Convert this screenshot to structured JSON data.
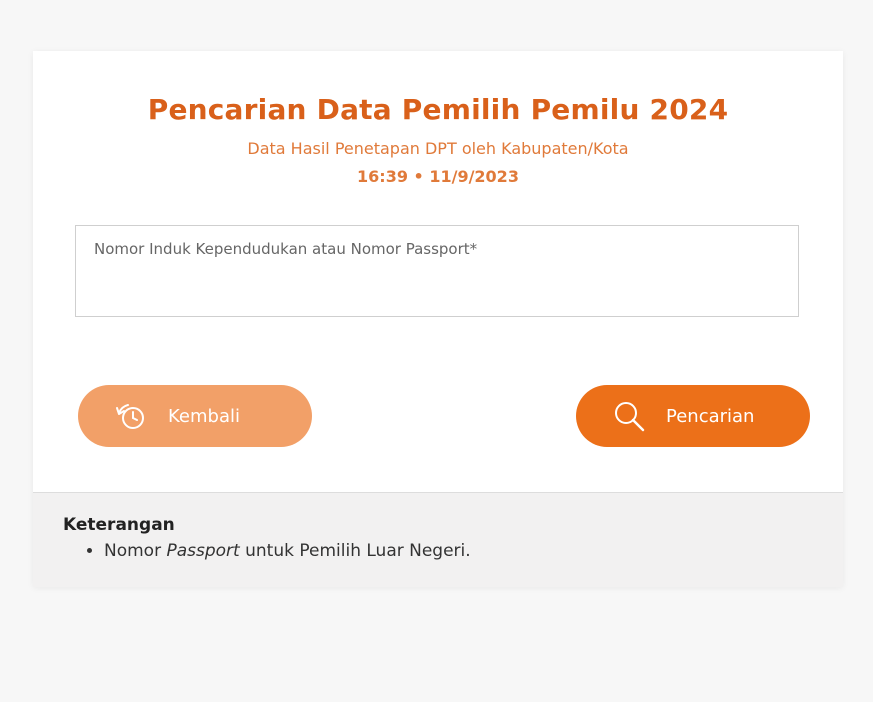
{
  "header": {
    "title": "Pencarian Data Pemilih Pemilu 2024",
    "subtitle": "Data Hasil Penetapan DPT oleh Kabupaten/Kota",
    "datetime": "16:39 • 11/9/2023"
  },
  "form": {
    "id_input_placeholder": "Nomor Induk Kependudukan atau Nomor Passport*",
    "id_input_value": ""
  },
  "buttons": {
    "back_label": "Kembali",
    "back_icon": "history-clock-icon",
    "search_label": "Pencarian",
    "search_icon": "search-icon"
  },
  "footer": {
    "title": "Keterangan",
    "notes": [
      {
        "prefix": "Nomor ",
        "emphasis": "Passport",
        "suffix": " untuk Pemilih Luar Negeri."
      }
    ]
  },
  "colors": {
    "accent": "#ec7019",
    "accent_light": "#f2a068",
    "title": "#d9601a"
  }
}
